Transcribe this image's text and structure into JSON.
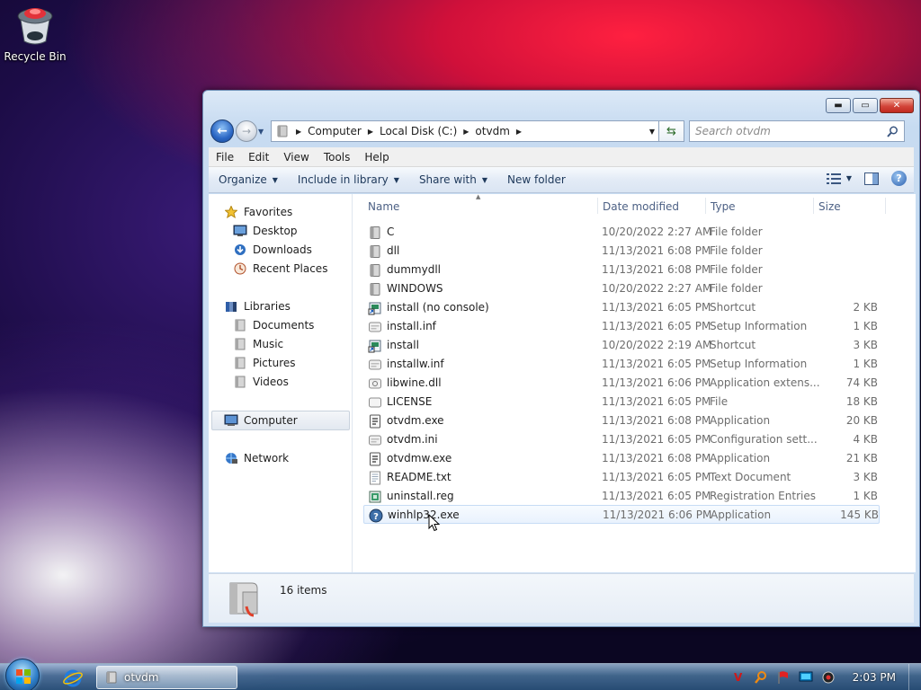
{
  "desktop": {
    "recycle_bin_label": "Recycle Bin"
  },
  "window": {
    "caption_buttons": {
      "minimize": "▬",
      "maximize": "▭",
      "close": "✕"
    },
    "address": {
      "segments": [
        "Computer",
        "Local Disk (C:)",
        "otvdm"
      ]
    },
    "search_placeholder": "Search otvdm",
    "menu": [
      "File",
      "Edit",
      "View",
      "Tools",
      "Help"
    ],
    "commands": {
      "organize": "Organize",
      "include_in_library": "Include in library",
      "share_with": "Share with",
      "new_folder": "New folder"
    },
    "nav_pane": {
      "favorites": "Favorites",
      "desktop": "Desktop",
      "downloads": "Downloads",
      "recent_places": "Recent Places",
      "libraries": "Libraries",
      "documents": "Documents",
      "music": "Music",
      "pictures": "Pictures",
      "videos": "Videos",
      "computer": "Computer",
      "network": "Network"
    },
    "columns": {
      "name": "Name",
      "date_modified": "Date modified",
      "type": "Type",
      "size": "Size"
    },
    "files": [
      {
        "name": "C",
        "date": "10/20/2022 2:27 AM",
        "type": "File folder",
        "size": "",
        "icon": "folder-icon"
      },
      {
        "name": "dll",
        "date": "11/13/2021 6:08 PM",
        "type": "File folder",
        "size": "",
        "icon": "folder-icon"
      },
      {
        "name": "dummydll",
        "date": "11/13/2021 6:08 PM",
        "type": "File folder",
        "size": "",
        "icon": "folder-icon"
      },
      {
        "name": "WINDOWS",
        "date": "10/20/2022 2:27 AM",
        "type": "File folder",
        "size": "",
        "icon": "folder-icon"
      },
      {
        "name": "install (no console)",
        "date": "11/13/2021 6:05 PM",
        "type": "Shortcut",
        "size": "2 KB",
        "icon": "shortcut-icon"
      },
      {
        "name": "install.inf",
        "date": "11/13/2021 6:05 PM",
        "type": "Setup Information",
        "size": "1 KB",
        "icon": "ini-file-icon"
      },
      {
        "name": "install",
        "date": "10/20/2022 2:19 AM",
        "type": "Shortcut",
        "size": "3 KB",
        "icon": "shortcut-icon"
      },
      {
        "name": "installw.inf",
        "date": "11/13/2021 6:05 PM",
        "type": "Setup Information",
        "size": "1 KB",
        "icon": "ini-file-icon"
      },
      {
        "name": "libwine.dll",
        "date": "11/13/2021 6:06 PM",
        "type": "Application extens...",
        "size": "74 KB",
        "icon": "dll-file-icon"
      },
      {
        "name": "LICENSE",
        "date": "11/13/2021 6:05 PM",
        "type": "File",
        "size": "18 KB",
        "icon": "blank-file-icon"
      },
      {
        "name": "otvdm.exe",
        "date": "11/13/2021 6:08 PM",
        "type": "Application",
        "size": "20 KB",
        "icon": "exe-file-icon"
      },
      {
        "name": "otvdm.ini",
        "date": "11/13/2021 6:05 PM",
        "type": "Configuration sett...",
        "size": "4 KB",
        "icon": "ini-file-icon"
      },
      {
        "name": "otvdmw.exe",
        "date": "11/13/2021 6:08 PM",
        "type": "Application",
        "size": "21 KB",
        "icon": "exe-file-icon"
      },
      {
        "name": "README.txt",
        "date": "11/13/2021 6:05 PM",
        "type": "Text Document",
        "size": "3 KB",
        "icon": "text-file-icon"
      },
      {
        "name": "uninstall.reg",
        "date": "11/13/2021 6:05 PM",
        "type": "Registration Entries",
        "size": "1 KB",
        "icon": "reg-file-icon"
      },
      {
        "name": "winhlp32.exe",
        "date": "11/13/2021 6:06 PM",
        "type": "Application",
        "size": "145 KB",
        "icon": "help-exe-icon"
      }
    ],
    "status": {
      "item_count": "16 items"
    }
  },
  "taskbar": {
    "task_label": "otvdm",
    "clock": "2:03 PM"
  }
}
